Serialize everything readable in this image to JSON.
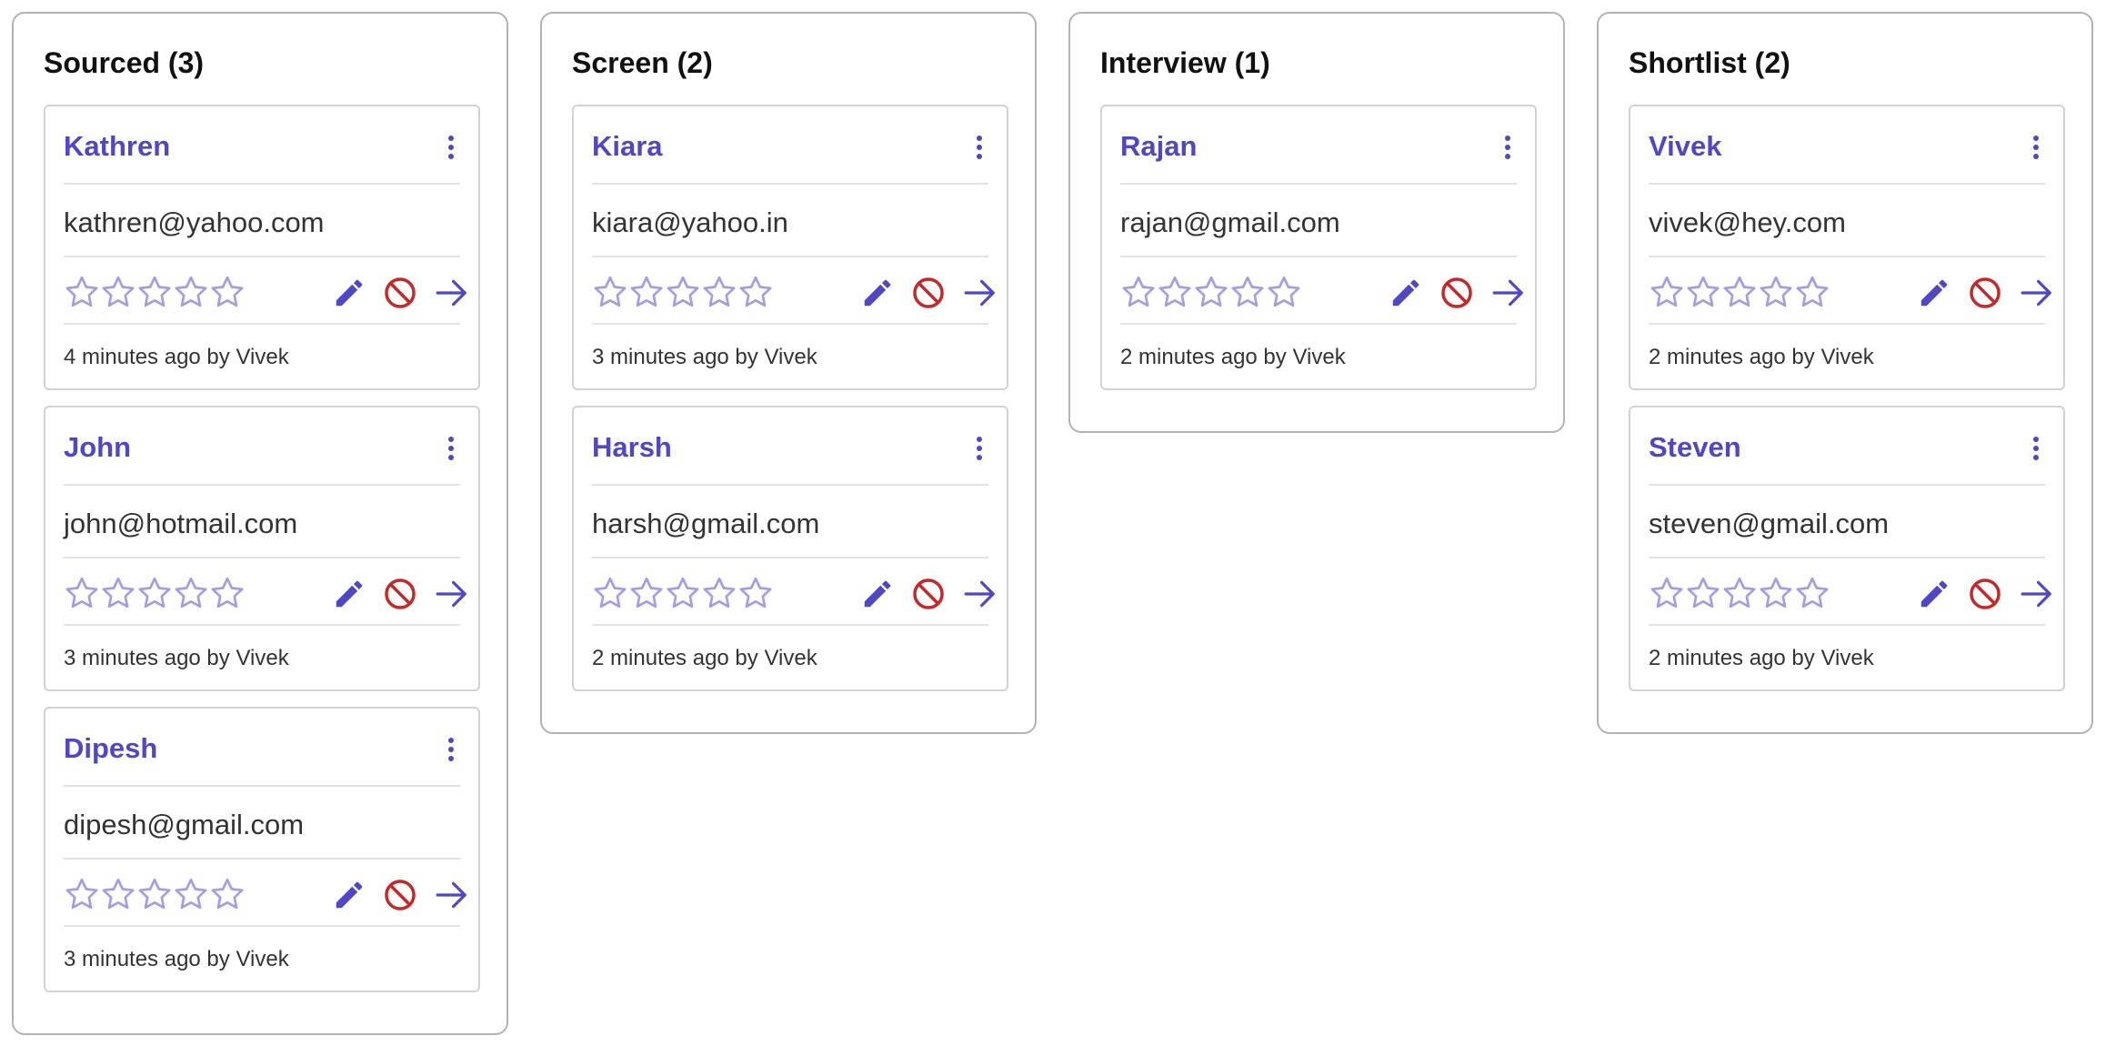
{
  "colors": {
    "accent": "#4f46c8",
    "star": "#a29cea",
    "danger": "#c62828",
    "border": "#b3b3b3"
  },
  "icons": {
    "menu": "kebab-menu-icon",
    "star": "star-outline-icon",
    "edit": "pencil-icon",
    "reject": "ban-icon",
    "advance": "arrow-right-icon"
  },
  "columns": [
    {
      "title": "Sourced (3)",
      "cards": [
        {
          "name": "Kathren",
          "email": "kathren@yahoo.com",
          "rating": 0,
          "meta": "4 minutes ago by Vivek"
        },
        {
          "name": "John",
          "email": "john@hotmail.com",
          "rating": 0,
          "meta": "3 minutes ago by Vivek"
        },
        {
          "name": "Dipesh",
          "email": "dipesh@gmail.com",
          "rating": 0,
          "meta": "3 minutes ago by Vivek"
        }
      ]
    },
    {
      "title": "Screen (2)",
      "cards": [
        {
          "name": "Kiara",
          "email": "kiara@yahoo.in",
          "rating": 0,
          "meta": "3 minutes ago by Vivek"
        },
        {
          "name": "Harsh",
          "email": "harsh@gmail.com",
          "rating": 0,
          "meta": "2 minutes ago by Vivek"
        }
      ]
    },
    {
      "title": "Interview (1)",
      "cards": [
        {
          "name": "Rajan",
          "email": "rajan@gmail.com",
          "rating": 0,
          "meta": "2 minutes ago by Vivek"
        }
      ]
    },
    {
      "title": "Shortlist (2)",
      "cards": [
        {
          "name": "Vivek",
          "email": "vivek@hey.com",
          "rating": 0,
          "meta": "2 minutes ago by Vivek"
        },
        {
          "name": "Steven",
          "email": "steven@gmail.com",
          "rating": 0,
          "meta": "2 minutes ago by Vivek"
        }
      ]
    }
  ]
}
